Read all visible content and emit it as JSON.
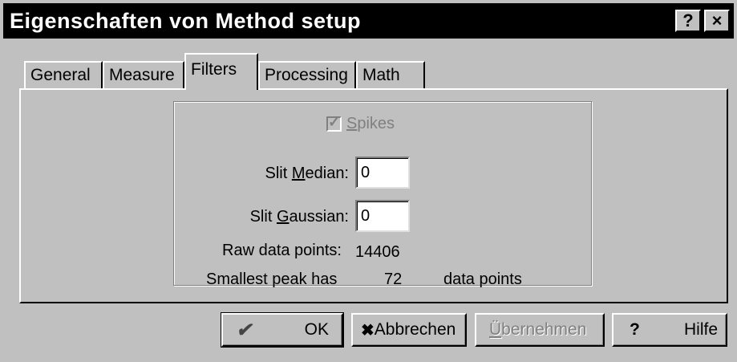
{
  "window": {
    "title": "Eigenschaften von Method setup",
    "help_glyph": "?",
    "close_glyph": "×"
  },
  "tabs": [
    {
      "label": "General",
      "active": false
    },
    {
      "label": "Measure",
      "active": false
    },
    {
      "label": "Filters",
      "active": true
    },
    {
      "label": "Processing",
      "active": false
    },
    {
      "label": "Math",
      "active": false
    }
  ],
  "filters": {
    "spikes": {
      "label_accel": "S",
      "label_rest": "pikes",
      "checked": true,
      "enabled": false
    },
    "slit_median": {
      "label_pre": "Slit ",
      "label_accel": "M",
      "label_rest": "edian:",
      "value": "0"
    },
    "slit_gaussian": {
      "label_pre": "Slit ",
      "label_accel": "G",
      "label_rest": "aussian:",
      "value": "0"
    },
    "raw_data_points": {
      "label": "Raw data points:",
      "value": "14406"
    },
    "smallest_peak": {
      "label": "Smallest peak has",
      "value": "72",
      "unit": "data points"
    }
  },
  "buttons": {
    "ok": {
      "glyph": "✔",
      "label": "OK"
    },
    "cancel": {
      "glyph": "✖",
      "label": "Abbrechen"
    },
    "apply": {
      "label_accel": "Ü",
      "label_rest": "bernehmen",
      "enabled": false
    },
    "help": {
      "glyph": "?",
      "label": "Hilfe"
    }
  },
  "colors": {
    "face": "#c0c0c0",
    "title_bg": "#000000",
    "disabled_text": "#808080"
  }
}
